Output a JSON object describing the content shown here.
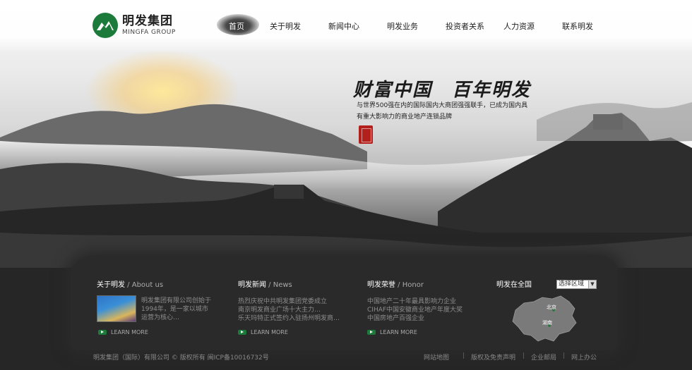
{
  "brand": {
    "name_cn": "明发集团",
    "name_en": "MINGFA GROUP"
  },
  "nav": {
    "items": [
      {
        "label": "首页",
        "active": true
      },
      {
        "label": "关于明发",
        "active": false
      },
      {
        "label": "新闻中心",
        "active": false
      },
      {
        "label": "明发业务",
        "active": false
      },
      {
        "label": "投资者关系",
        "active": false
      },
      {
        "label": "人力资源",
        "active": false
      },
      {
        "label": "联系明发",
        "active": false
      }
    ]
  },
  "hero": {
    "slogan": "财富中国　百年明发",
    "description": "与世界500强在内的国际国内大商团强强联手，已成为国内具有重大影响力的商业地产连锁品牌"
  },
  "sections": {
    "about": {
      "title_cn": "关于明发",
      "title_en": "About us",
      "text": "明发集团有限公司创始于1994年，是一家以城市运营为核心…",
      "learn_more": "LEARN MORE"
    },
    "news": {
      "title_cn": "明发新闻",
      "title_en": "News",
      "items": [
        "热烈庆祝中共明发集团党委成立",
        "南京明发商业广场十大主力…",
        "乐天玛特正式签约入驻扬州明发商…"
      ],
      "learn_more": "LEARN MORE"
    },
    "honor": {
      "title_cn": "明发荣誉",
      "title_en": "Honor",
      "items": [
        "中国地产二十年最具影响力企业",
        "CIHAF中国安徽商业地产年度大奖",
        "中国房地产百强企业"
      ],
      "learn_more": "LEARN MORE"
    },
    "national": {
      "title": "明发在全国",
      "select_value": "选择区域",
      "map_labels": [
        "北京",
        "湖南"
      ]
    }
  },
  "footer": {
    "copyright": "明发集团（国际）有限公司 © 版权所有 闽ICP备10016732号",
    "links": [
      "网站地图",
      "版权及免责声明",
      "企业邮局",
      "网上办公"
    ],
    "separator": "|"
  },
  "colors": {
    "brand_green": "#1c7a3a",
    "seal_red": "#b3201c",
    "panel_dark": "#2a2a2a"
  }
}
